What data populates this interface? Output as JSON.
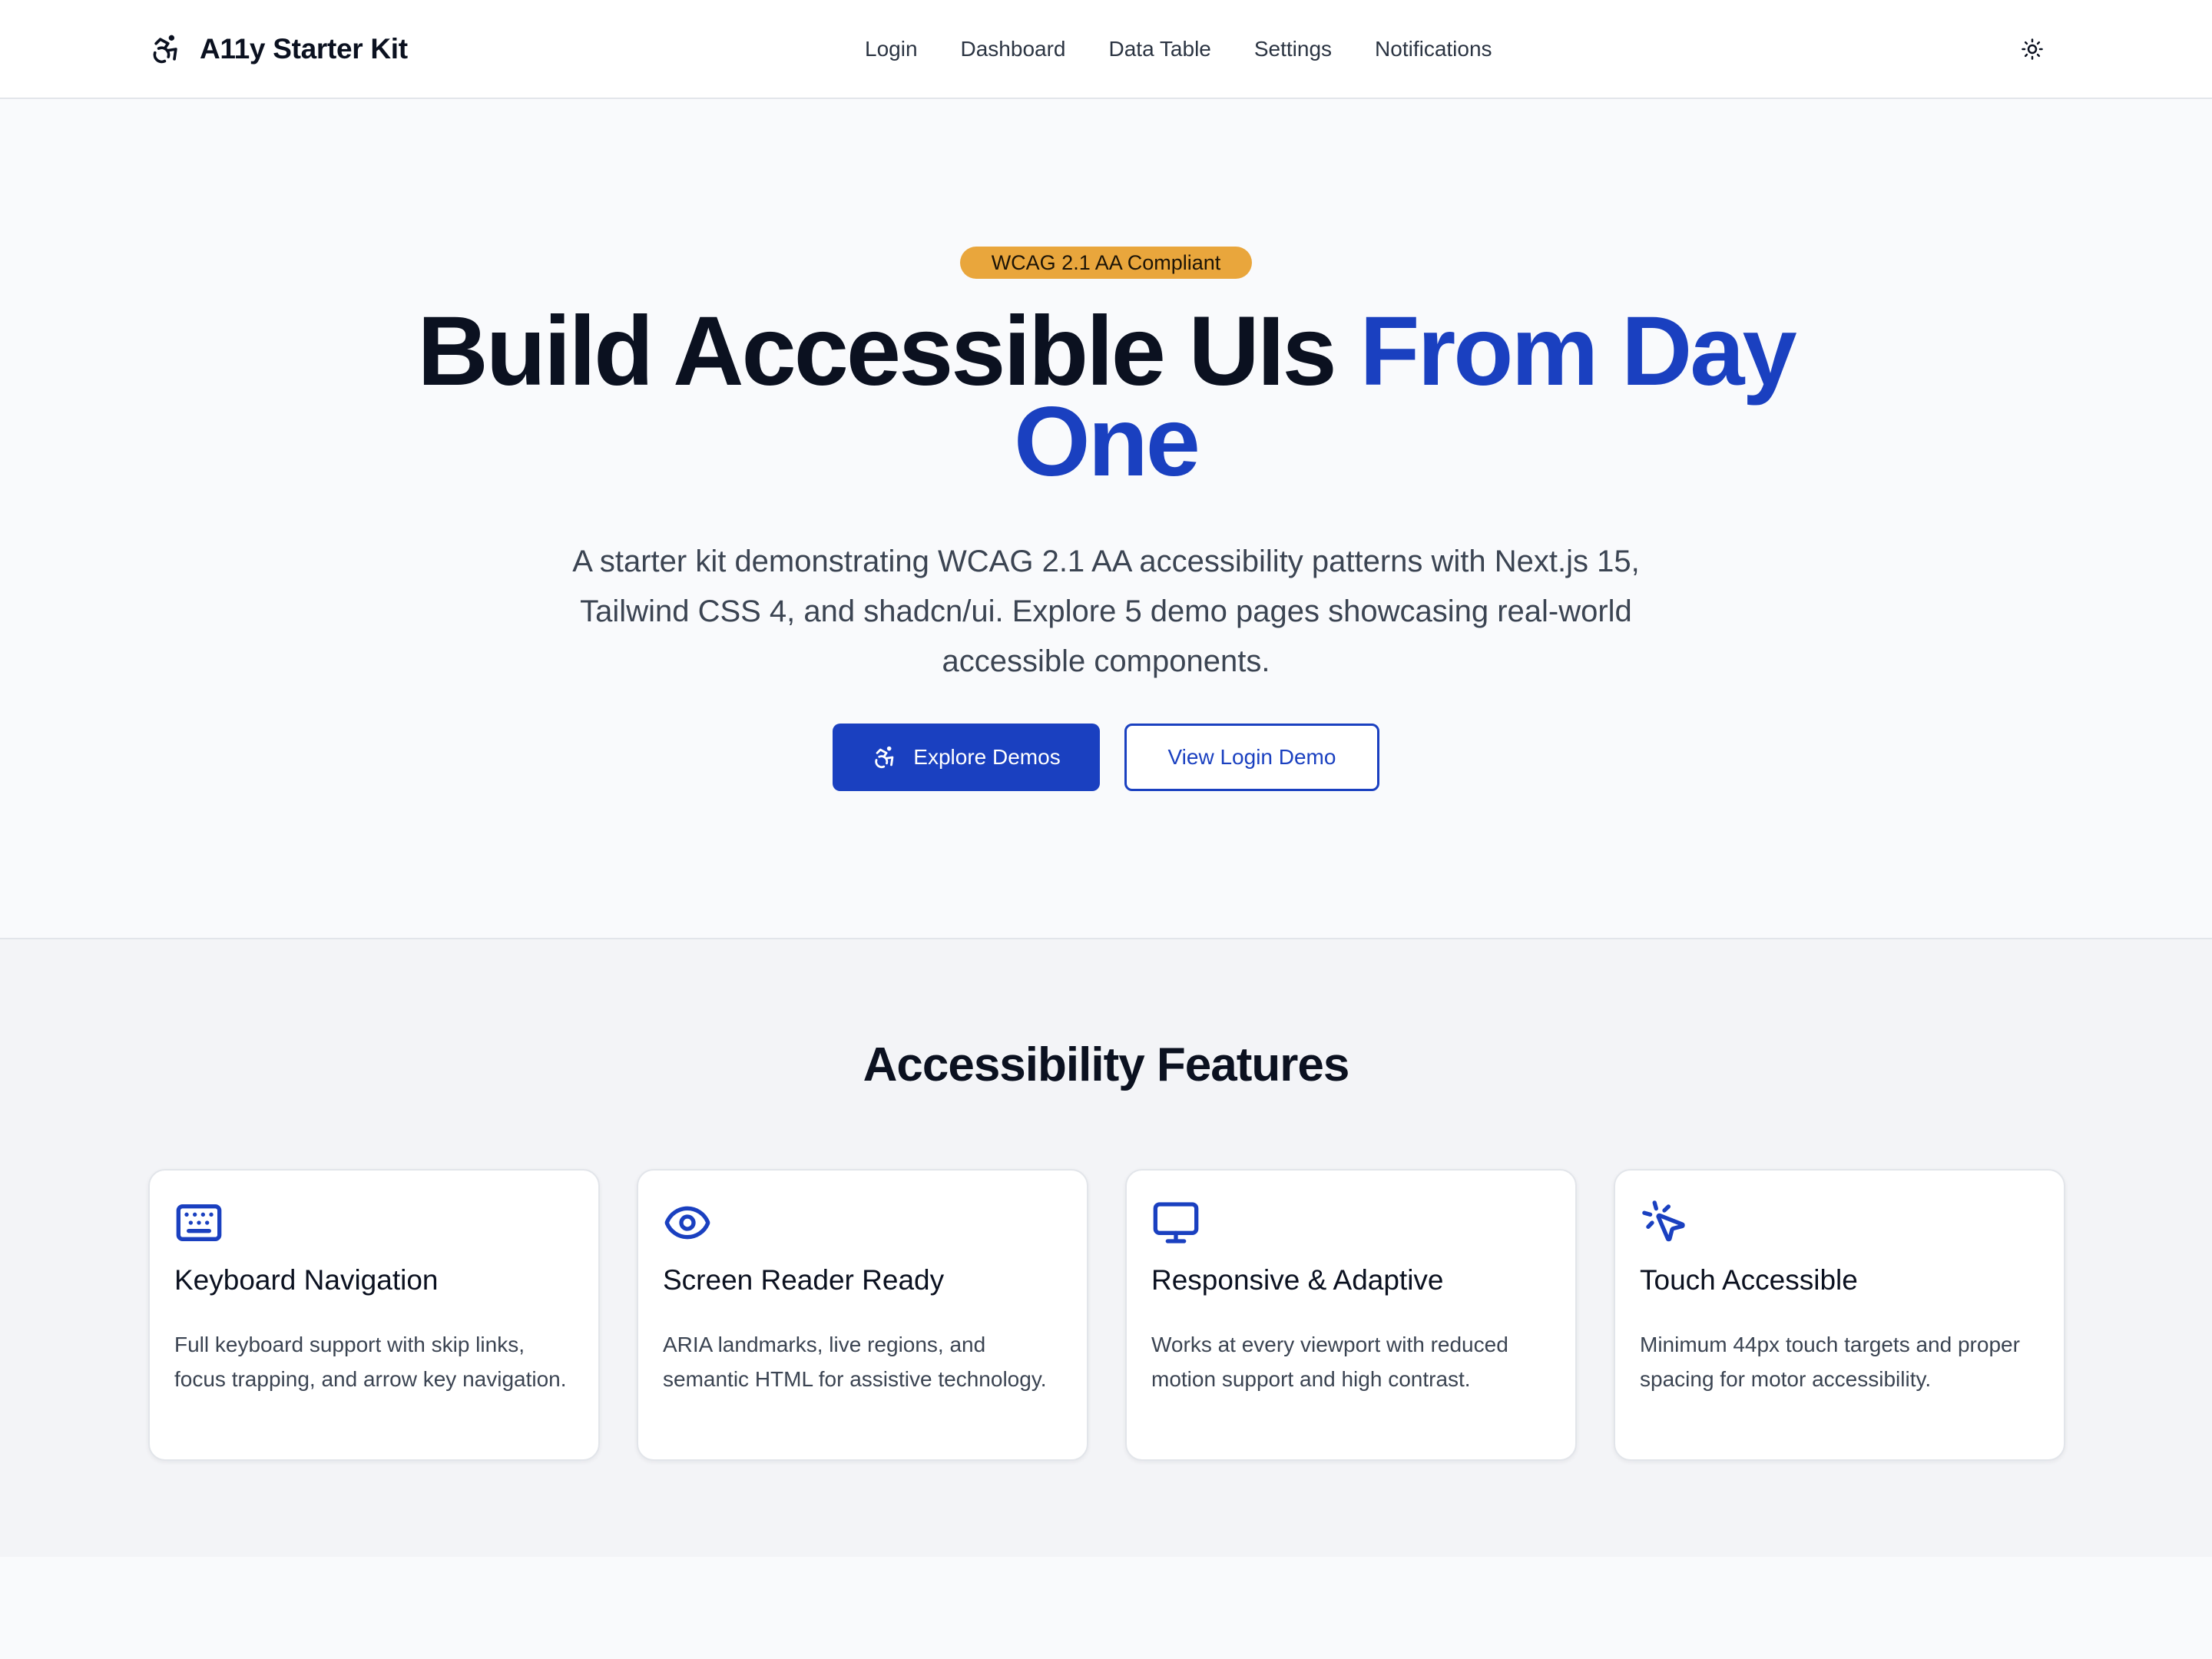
{
  "header": {
    "brand": "A11y Starter Kit",
    "nav": [
      "Login",
      "Dashboard",
      "Data Table",
      "Settings",
      "Notifications"
    ],
    "theme_icon": "sun-icon"
  },
  "hero": {
    "badge": "WCAG 2.1 AA Compliant",
    "title_plain": "Build Accessible UIs",
    "title_accent": "From Day One",
    "subtitle": "A starter kit demonstrating WCAG 2.1 AA accessibility patterns with Next.js 15, Tailwind CSS 4, and shadcn/ui. Explore 5 demo pages showcasing real-world accessible components.",
    "primary_button": "Explore Demos",
    "secondary_button": "View Login Demo"
  },
  "features": {
    "title": "Accessibility Features",
    "cards": [
      {
        "icon": "keyboard-icon",
        "title": "Keyboard Navigation",
        "description": "Full keyboard support with skip links, focus trapping, and arrow key navigation."
      },
      {
        "icon": "eye-icon",
        "title": "Screen Reader Ready",
        "description": "ARIA landmarks, live regions, and semantic HTML for assistive technology."
      },
      {
        "icon": "monitor-icon",
        "title": "Responsive & Adaptive",
        "description": "Works at every viewport with reduced motion support and high contrast."
      },
      {
        "icon": "pointer-click-icon",
        "title": "Touch Accessible",
        "description": "Minimum 44px touch targets and proper spacing for motor accessibility."
      }
    ]
  },
  "colors": {
    "primary": "#1a40c0",
    "badge": "#e9a63c",
    "text": "#0b1120",
    "muted_text": "#3b4452",
    "page_bg": "#f9fafc",
    "section_bg": "#f3f4f7"
  }
}
